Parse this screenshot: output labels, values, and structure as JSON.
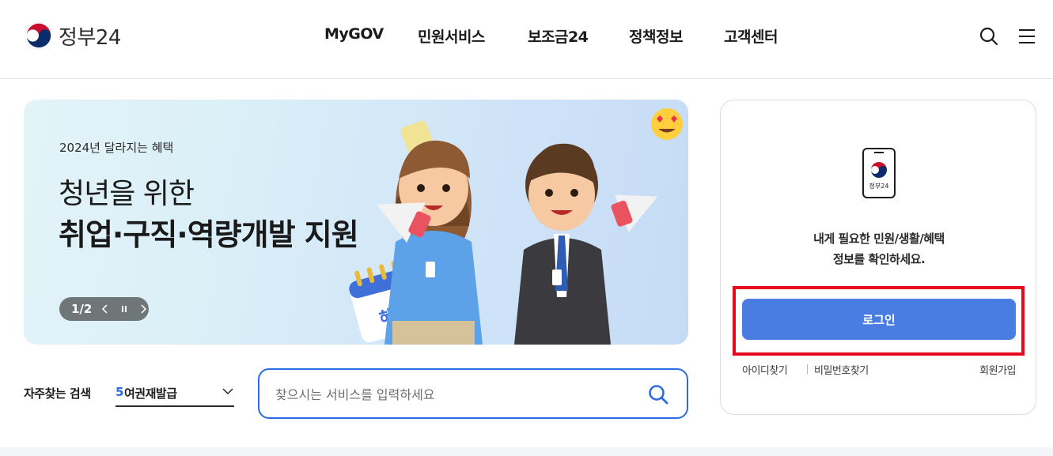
{
  "header": {
    "logo_text": "정부24",
    "nav": [
      "MyGOV",
      "민원서비스",
      "보조금24",
      "정책정보",
      "고객센터"
    ],
    "icons": [
      "search-icon",
      "hamburger-menu-icon"
    ]
  },
  "banner": {
    "subtitle": "2024년 달라지는 혜택",
    "title_line1": "청년을 위한",
    "title_line2": "취업·구직·역량개발 지원",
    "page_indicator": "1/2",
    "calendar_label": "혜택",
    "controls": [
      "chevron-left-icon",
      "pause-icon",
      "chevron-right-icon"
    ]
  },
  "search": {
    "frequent_label": "자주찾는 검색",
    "frequent_rank": "5",
    "frequent_value": "여권재발급",
    "placeholder": "찾으시는 서비스를 입력하세요"
  },
  "login_card": {
    "app_label": "정부24",
    "message_line1": "내게 필요한 민원/생활/혜택",
    "message_line2": "정보를 확인하세요.",
    "login_button": "로그인",
    "find_id": "아이디찾기",
    "find_password": "비밀번호찾기",
    "signup": "회원가입"
  },
  "colors": {
    "primary_blue": "#2d6be6",
    "login_button": "#4a7de2",
    "highlight_red": "#e8091e",
    "control_gray": "#6e7678"
  }
}
